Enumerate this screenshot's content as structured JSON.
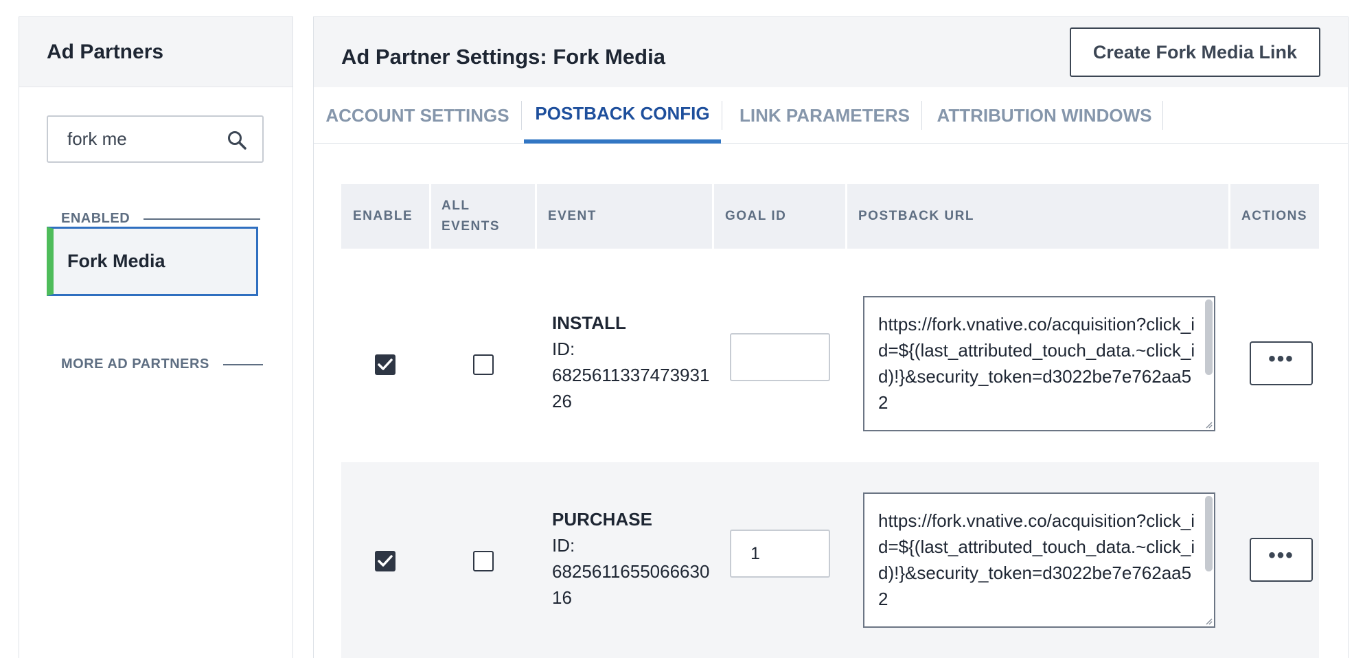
{
  "sidebar": {
    "title": "Ad Partners",
    "search": {
      "value": "fork me",
      "placeholder": ""
    },
    "sections": {
      "enabled": "ENABLED",
      "more": "MORE AD PARTNERS"
    },
    "enabled_partners": [
      {
        "label": "Fork Media"
      }
    ]
  },
  "header": {
    "title": "Ad Partner Settings: Fork Media",
    "create_button": "Create Fork Media Link"
  },
  "tabs": [
    {
      "label": "ACCOUNT SETTINGS",
      "active": false
    },
    {
      "label": "POSTBACK CONFIG",
      "active": true
    },
    {
      "label": "LINK PARAMETERS",
      "active": false
    },
    {
      "label": "ATTRIBUTION WINDOWS",
      "active": false
    }
  ],
  "table": {
    "columns": {
      "enable": "ENABLE",
      "all_events_1": "ALL",
      "all_events_2": "EVENTS",
      "event": "EVENT",
      "goal_id": "GOAL ID",
      "postback_url": "POSTBACK URL",
      "actions": "ACTIONS"
    },
    "rows": [
      {
        "enabled": true,
        "all_events": false,
        "event_name": "INSTALL",
        "id_label": "ID:",
        "event_id": "682561133747393126",
        "goal_id": "",
        "postback_url": "https://fork.vnative.co/acquisition?click_id=${(last_attributed_touch_data.~click_id)!}&security_token=d3022be7e762aa52",
        "actions_label": "•••"
      },
      {
        "enabled": true,
        "all_events": false,
        "event_name": "PURCHASE",
        "id_label": "ID:",
        "event_id": "682561165506663016",
        "goal_id": "1",
        "postback_url": "https://fork.vnative.co/acquisition?click_id=${(last_attributed_touch_data.~click_id)!}&security_token=d3022be7e762aa52",
        "actions_label": "•••"
      }
    ]
  },
  "colors": {
    "accent_tab": "#3276c3",
    "enabled_marker": "#4ebc5a",
    "selected_border": "#2f6fc0"
  }
}
